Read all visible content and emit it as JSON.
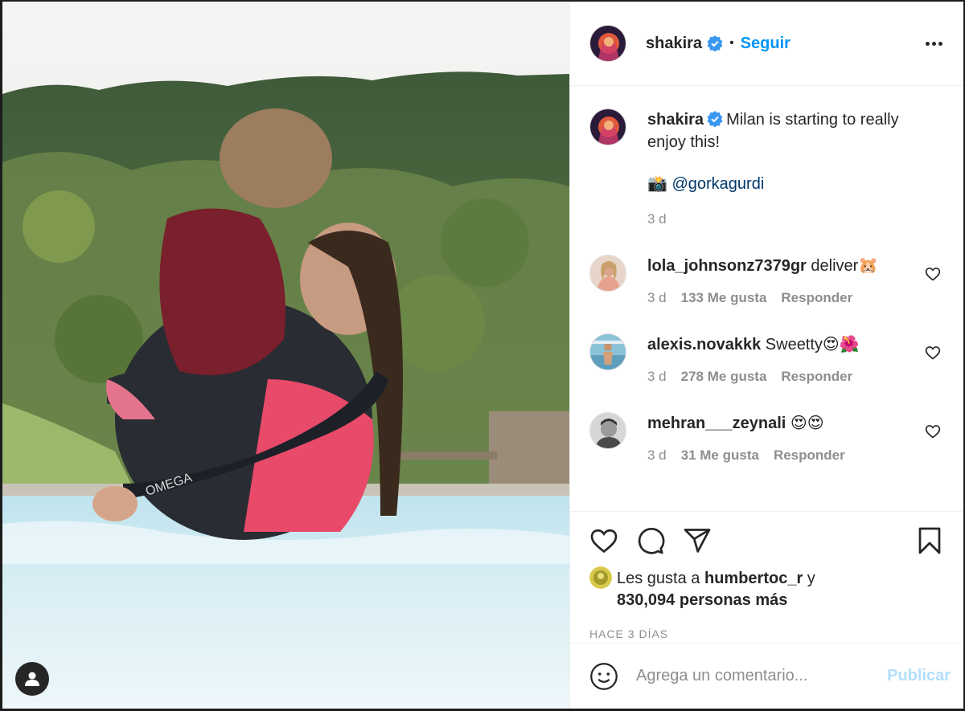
{
  "post": {
    "author": "shakira",
    "follow_label": "Seguir",
    "separator": "•",
    "caption_text": "Milan is starting to really enjoy this!",
    "caption_credit_icon": "📸",
    "caption_mention": "@gorkagurdi",
    "caption_age": "3 d"
  },
  "comments": [
    {
      "user": "lola_johnsonz7379gr",
      "text": "deliver🐹",
      "age": "3 d",
      "likes": "133 Me gusta",
      "reply": "Responder"
    },
    {
      "user": "alexis.novakkk",
      "text": "Sweetty😍🌺",
      "age": "3 d",
      "likes": "278 Me gusta",
      "reply": "Responder"
    },
    {
      "user": "mehran___zeynali",
      "text": "😍😍",
      "age": "3 d",
      "likes": "31 Me gusta",
      "reply": "Responder"
    }
  ],
  "likes": {
    "prefix": "Les gusta a",
    "user": "humbertoc_r",
    "conj": "y",
    "others": "830,094 personas más"
  },
  "timestamp": "HACE 3 DÍAS",
  "comment_box": {
    "placeholder": "Agrega un comentario...",
    "publish_label": "Publicar"
  },
  "colors": {
    "accent": "#0095f6",
    "publish_disabled": "#b2dffc",
    "verified": "#3897f0"
  }
}
